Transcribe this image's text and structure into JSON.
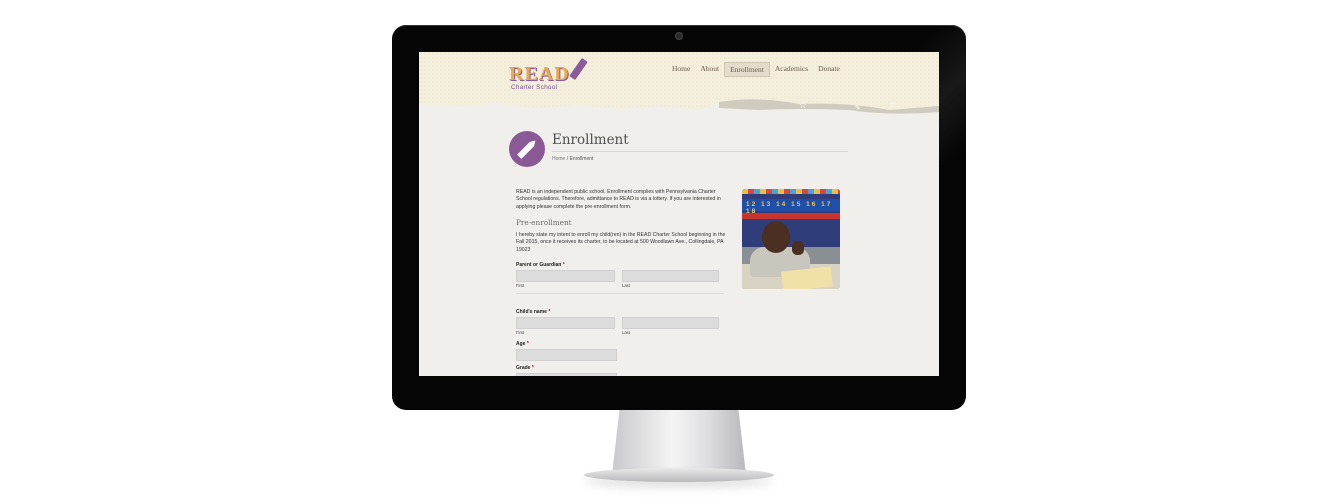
{
  "site": {
    "logo": {
      "main": "READ",
      "sub": "Charter School"
    },
    "nav": [
      "Home",
      "About",
      "Enrollment",
      "Academics",
      "Donate"
    ],
    "active_nav": "Enrollment"
  },
  "page": {
    "title": "Enrollment",
    "breadcrumb": {
      "home": "Home",
      "separator": "/",
      "current": "Enrollment"
    },
    "intro": "READ is an independent public school. Enrollment complies with Pennsylvania Charter School regulations. Therefore, admittance to READ is via a lottery. If you are interested in applying please complete the pre-enrollment form.",
    "section_title": "Pre-enrollment",
    "intent": "I hereby state my intent to enroll my child(ren) in the READ Charter School beginning in the Fall 2015, once it receives its charter, to be located at 500 Woodlawn Ave., Collingdale, PA 19023"
  },
  "form": {
    "parent": {
      "label": "Parent or Guardian",
      "required": "*",
      "first": "First",
      "last": "Last"
    },
    "child": {
      "label": "Child's name",
      "required": "*",
      "first": "First",
      "last": "Last"
    },
    "age": {
      "label": "Age",
      "required": "*"
    },
    "grade": {
      "label": "Grade",
      "required": "*"
    }
  },
  "photo": {
    "numbers": "12 13 14 15 16 17 18"
  },
  "colors": {
    "brand_purple": "#8a5a97",
    "logo_gold": "#e7a94a",
    "header_bg": "#f4eedd",
    "page_bg": "#f0efec"
  }
}
